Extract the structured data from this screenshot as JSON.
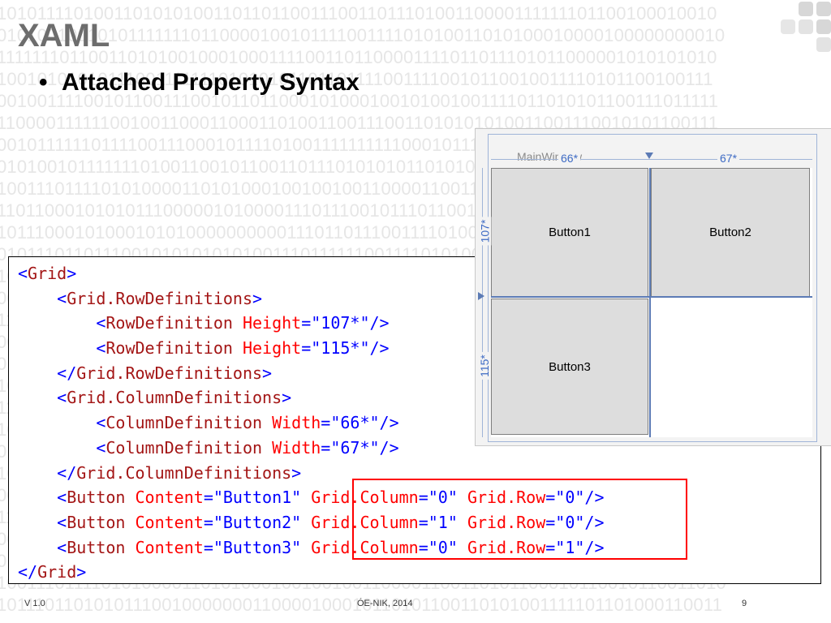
{
  "slide": {
    "title": "XAML",
    "bullet": "Attached Property Syntax",
    "footer_left": "V 1.0",
    "footer_center": "ÓE-NIK, 2014",
    "page_number": "9"
  },
  "designer": {
    "window_title": "MainWindow",
    "col_labels": [
      "66*",
      "67*"
    ],
    "row_labels": [
      "107*",
      "115*"
    ],
    "buttons": [
      "Button1",
      "Button2",
      "Button3"
    ]
  },
  "code": {
    "lines": [
      [
        {
          "t": "<",
          "c": "punct"
        },
        {
          "t": "Grid",
          "c": "tag"
        },
        {
          "t": ">",
          "c": "punct"
        }
      ],
      [
        {
          "t": "    <",
          "c": "punct"
        },
        {
          "t": "Grid.RowDefinitions",
          "c": "tag"
        },
        {
          "t": ">",
          "c": "punct"
        }
      ],
      [
        {
          "t": "        <",
          "c": "punct"
        },
        {
          "t": "RowDefinition",
          "c": "tag"
        },
        {
          "t": " ",
          "c": "punct"
        },
        {
          "t": "Height",
          "c": "attr"
        },
        {
          "t": "=\"107*\"/>",
          "c": "val"
        }
      ],
      [
        {
          "t": "        <",
          "c": "punct"
        },
        {
          "t": "RowDefinition",
          "c": "tag"
        },
        {
          "t": " ",
          "c": "punct"
        },
        {
          "t": "Height",
          "c": "attr"
        },
        {
          "t": "=\"115*\"/>",
          "c": "val"
        }
      ],
      [
        {
          "t": "    </",
          "c": "punct"
        },
        {
          "t": "Grid.RowDefinitions",
          "c": "tag"
        },
        {
          "t": ">",
          "c": "punct"
        }
      ],
      [
        {
          "t": "    <",
          "c": "punct"
        },
        {
          "t": "Grid.ColumnDefinitions",
          "c": "tag"
        },
        {
          "t": ">",
          "c": "punct"
        }
      ],
      [
        {
          "t": "        <",
          "c": "punct"
        },
        {
          "t": "ColumnDefinition",
          "c": "tag"
        },
        {
          "t": " ",
          "c": "punct"
        },
        {
          "t": "Width",
          "c": "attr"
        },
        {
          "t": "=\"66*\"/>",
          "c": "val"
        }
      ],
      [
        {
          "t": "        <",
          "c": "punct"
        },
        {
          "t": "ColumnDefinition",
          "c": "tag"
        },
        {
          "t": " ",
          "c": "punct"
        },
        {
          "t": "Width",
          "c": "attr"
        },
        {
          "t": "=\"67*\"/>",
          "c": "val"
        }
      ],
      [
        {
          "t": "    </",
          "c": "punct"
        },
        {
          "t": "Grid.ColumnDefinitions",
          "c": "tag"
        },
        {
          "t": ">",
          "c": "punct"
        }
      ],
      [
        {
          "t": "    <",
          "c": "punct"
        },
        {
          "t": "Button",
          "c": "tag"
        },
        {
          "t": " ",
          "c": "punct"
        },
        {
          "t": "Content",
          "c": "attr"
        },
        {
          "t": "=\"Button1\" ",
          "c": "val"
        },
        {
          "t": "Grid.Column",
          "c": "attr"
        },
        {
          "t": "=\"0\" ",
          "c": "val"
        },
        {
          "t": "Grid.Row",
          "c": "attr"
        },
        {
          "t": "=\"0\"/>",
          "c": "val"
        }
      ],
      [
        {
          "t": "    <",
          "c": "punct"
        },
        {
          "t": "Button",
          "c": "tag"
        },
        {
          "t": " ",
          "c": "punct"
        },
        {
          "t": "Content",
          "c": "attr"
        },
        {
          "t": "=\"Button2\" ",
          "c": "val"
        },
        {
          "t": "Grid.Column",
          "c": "attr"
        },
        {
          "t": "=\"1\" ",
          "c": "val"
        },
        {
          "t": "Grid.Row",
          "c": "attr"
        },
        {
          "t": "=\"0\"/>",
          "c": "val"
        }
      ],
      [
        {
          "t": "    <",
          "c": "punct"
        },
        {
          "t": "Button",
          "c": "tag"
        },
        {
          "t": " ",
          "c": "punct"
        },
        {
          "t": "Content",
          "c": "attr"
        },
        {
          "t": "=\"Button3\" ",
          "c": "val"
        },
        {
          "t": "Grid.Column",
          "c": "attr"
        },
        {
          "t": "=\"0\" ",
          "c": "val"
        },
        {
          "t": "Grid.Row",
          "c": "attr"
        },
        {
          "t": "=\"1\"/>",
          "c": "val"
        }
      ],
      [
        {
          "t": "</",
          "c": "punct"
        },
        {
          "t": "Grid",
          "c": "tag"
        },
        {
          "t": ">",
          "c": "punct"
        }
      ]
    ]
  },
  "background_binary": [
    "10101111010011010101001101101100111001101110100110000111111101100100010010",
    "01010010010101111111011000010010111100111101010011010100010000100000000010",
    "11111110110011010100100010001111001101100001111011011101011000001010101010",
    "10010101010111001111111010101011011011110011110010110010011110101100100111",
    "00100111100101100111001011011000101000100101001001111011010101100111011111",
    "11000011111100100110001100011010011001110011010101010011001110010101100111",
    "00101111110111100111000101111010011111111110001011101100111100010100101001",
    "01010010111111101001100101100110111010101011010100101110110011110101011001",
    "10011101111010100001101010001001001001100001100110101100010110010110011010",
    "11011000101010111000001010000111011100101110110010001101111001011011100110",
    "10111000101000101010000000000111011011100111101001101101011111011011010110",
    "01011101101110010101010101001110111111001111010100010101100011110011010101",
    "10010101010111001111111010101011011011110011110010110010011110101100100111",
    "00100111100101100111001011011000101000100101001001111011010101100111011111",
    "11000011111100100110001100011010011001110011010101010011001110010101100111",
    "00101111110111100111000101111010011111111110001011101100111100010100101001",
    "01010010111111101001100101100110111010101011010100101110110011110101011001",
    "10011101111010100001101010001001001001100001100110101100010110010110011010",
    "11011000101010111000001010000111011100101110110010001101111001011011100110",
    "10111000101000101010000000000111011011100111101001101101011111011011010110",
    "01011101101110010101010101001110111111001111010100010101100011110011010101",
    "10010101010111001111111010101011011011110011110010110010011110101100100111",
    "00100111100101100111001011011000101000100101001001111011010101100111011111",
    "11000011111100100110001100011010011001110011010101010011001110010101100111",
    "00101111110111100111000101111010011111111110001011101100111100010100101001",
    "01010010111111101001100101100110111010101011010100101110110011110101011001",
    "10011101111010100001101010001001001001100001100110101100010110010110011010",
    "10111011010101110010000000110000100010110101100110101001111101101000110011"
  ],
  "colors": {
    "title": "#6d6d6d",
    "xaml_tag": "#a31515",
    "xaml_attribute": "#ff0000",
    "xaml_punctuation": "#0000ff",
    "highlight_box": "#ff0000",
    "grid_lines": "#5c7bb5",
    "grid_labels": "#3e6bc4"
  }
}
